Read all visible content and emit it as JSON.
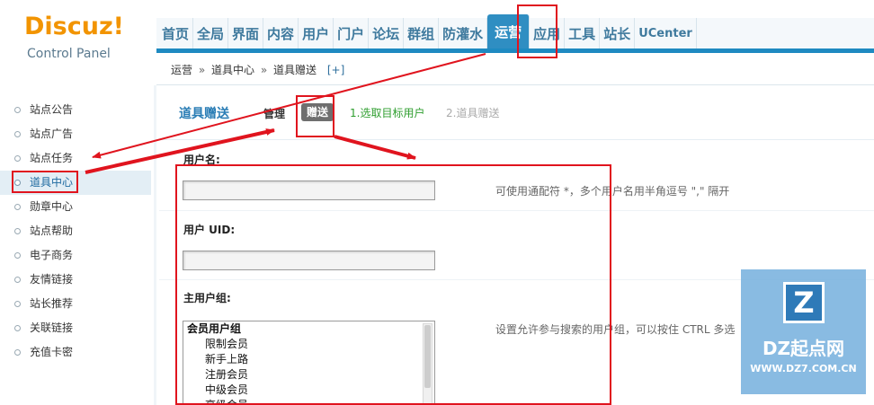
{
  "logo": {
    "brand": "Discuz!",
    "subtitle": "Control Panel"
  },
  "nav": {
    "items": [
      {
        "label": "首页"
      },
      {
        "label": "全局"
      },
      {
        "label": "界面"
      },
      {
        "label": "内容"
      },
      {
        "label": "用户"
      },
      {
        "label": "门户"
      },
      {
        "label": "论坛"
      },
      {
        "label": "群组"
      },
      {
        "label": "防灌水"
      },
      {
        "label": "运营",
        "active": true
      },
      {
        "label": "应用"
      },
      {
        "label": "工具"
      },
      {
        "label": "站长"
      },
      {
        "label": "UCenter"
      }
    ]
  },
  "breadcrumb": {
    "parts": [
      "运营",
      "道具中心",
      "道具赠送"
    ],
    "separator": "»",
    "add": "[+]"
  },
  "sidebar": {
    "items": [
      {
        "label": "站点公告"
      },
      {
        "label": "站点广告"
      },
      {
        "label": "站点任务"
      },
      {
        "label": "道具中心",
        "active": true
      },
      {
        "label": "勋章中心"
      },
      {
        "label": "站点帮助"
      },
      {
        "label": "电子商务"
      },
      {
        "label": "友情链接"
      },
      {
        "label": "站长推荐"
      },
      {
        "label": "关联链接"
      },
      {
        "label": "充值卡密"
      }
    ]
  },
  "main": {
    "title": "道具赠送",
    "tab_manage": "管理",
    "tab_give": "赠送",
    "step1": "1.选取目标用户",
    "step2": "2.道具赠送"
  },
  "form": {
    "username_label": "用户名:",
    "username_value": "",
    "username_hint": "可使用通配符 *，多个用户名用半角逗号 \",\" 隔开",
    "uid_label": "用户 UID:",
    "uid_value": "",
    "group_label": "主用户组:",
    "group_hint": "设置允许参与搜索的用户组，可以按住 CTRL 多选",
    "group_list": {
      "group": "会员用户组",
      "options": [
        "限制会员",
        "新手上路",
        "注册会员",
        "中级会员",
        "高级会员"
      ]
    }
  },
  "watermark": {
    "logo": "Z",
    "name": "DZ起点网",
    "url": "WWW.DZ7.COM.CN"
  },
  "colors": {
    "accent": "#2f8ec2",
    "annotation": "#e0141e",
    "logo_orange": "#f29400"
  }
}
